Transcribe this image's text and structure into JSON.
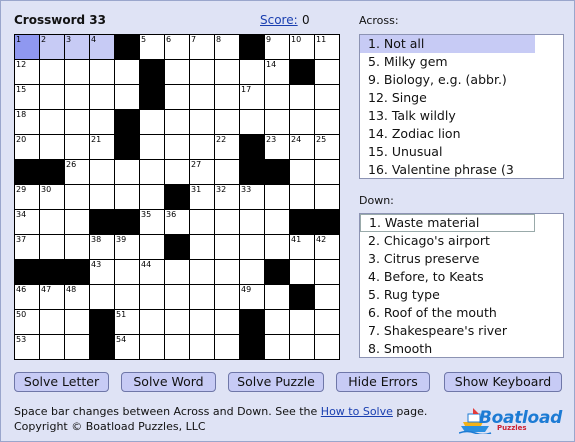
{
  "header": {
    "title": "Crossword 33",
    "score_label": "Score:",
    "score_value": "0"
  },
  "grid": {
    "rows": [
      "....#....#...",
      ".....#.....#.",
      ".....#.......",
      "....#........",
      "....#....#...",
      "##.......##..",
      "......#......",
      "...##......##",
      "......#......",
      "###.......#..",
      "...........#.",
      "...#.....#...",
      "...#.....#..."
    ],
    "numbers": [
      [
        1,
        2,
        3,
        4,
        0,
        5,
        6,
        7,
        8,
        0,
        9,
        10,
        11
      ],
      [
        12,
        0,
        0,
        0,
        0,
        13,
        0,
        0,
        0,
        0,
        14,
        0,
        0
      ],
      [
        15,
        0,
        0,
        0,
        0,
        16,
        0,
        0,
        0,
        17,
        0,
        0,
        0
      ],
      [
        18,
        0,
        0,
        0,
        19,
        0,
        0,
        0,
        0,
        0,
        0,
        0,
        0
      ],
      [
        20,
        0,
        0,
        21,
        0,
        0,
        0,
        0,
        22,
        0,
        23,
        24,
        25
      ],
      [
        0,
        0,
        26,
        0,
        0,
        0,
        0,
        27,
        0,
        0,
        28,
        0,
        0
      ],
      [
        29,
        30,
        0,
        0,
        0,
        0,
        0,
        31,
        32,
        33,
        0,
        0,
        0
      ],
      [
        34,
        0,
        0,
        0,
        0,
        35,
        36,
        0,
        0,
        0,
        0,
        0,
        0
      ],
      [
        37,
        0,
        0,
        38,
        39,
        0,
        40,
        0,
        0,
        0,
        0,
        41,
        42
      ],
      [
        0,
        0,
        0,
        43,
        0,
        44,
        0,
        0,
        0,
        0,
        45,
        0,
        0
      ],
      [
        46,
        47,
        48,
        0,
        0,
        0,
        0,
        0,
        0,
        49,
        0,
        0,
        0
      ],
      [
        50,
        0,
        0,
        0,
        51,
        0,
        0,
        0,
        0,
        52,
        0,
        0,
        0
      ],
      [
        53,
        0,
        0,
        0,
        54,
        0,
        0,
        0,
        0,
        55,
        0,
        0,
        0
      ]
    ],
    "current_cell": [
      0,
      0
    ],
    "highlight_cells": [
      [
        0,
        1
      ],
      [
        0,
        2
      ],
      [
        0,
        3
      ]
    ]
  },
  "across": {
    "heading": "Across:",
    "clues": [
      "1.  Not all",
      "5.  Milky gem",
      "9.  Biology, e.g. (abbr.)",
      "12.  Singe",
      "13.  Talk wildly",
      "14.  Zodiac lion",
      "15.  Unusual",
      "16.  Valentine phrase (3"
    ],
    "selected_index": 0
  },
  "down": {
    "heading": "Down:",
    "clues": [
      "1.  Waste material",
      "2.  Chicago's airport",
      "3.  Citrus preserve",
      "4.  Before, to Keats",
      "5.  Rug type",
      "6.  Roof of the mouth",
      "7.  Shakespeare's river",
      "8.  Smooth"
    ],
    "selected_index": 0
  },
  "buttons": {
    "solve_letter": "Solve Letter",
    "solve_word": "Solve Word",
    "solve_puzzle": "Solve Puzzle",
    "hide_errors": "Hide Errors",
    "show_keyboard": "Show Keyboard"
  },
  "footer": {
    "hint_before": "Space bar changes between Across and Down. See the ",
    "hint_link": "How to Solve",
    "hint_after": " page.",
    "copyright": "Copyright © Boatload Puzzles, LLC"
  },
  "logo": {
    "name": "Boatload",
    "sub": "Puzzles"
  }
}
